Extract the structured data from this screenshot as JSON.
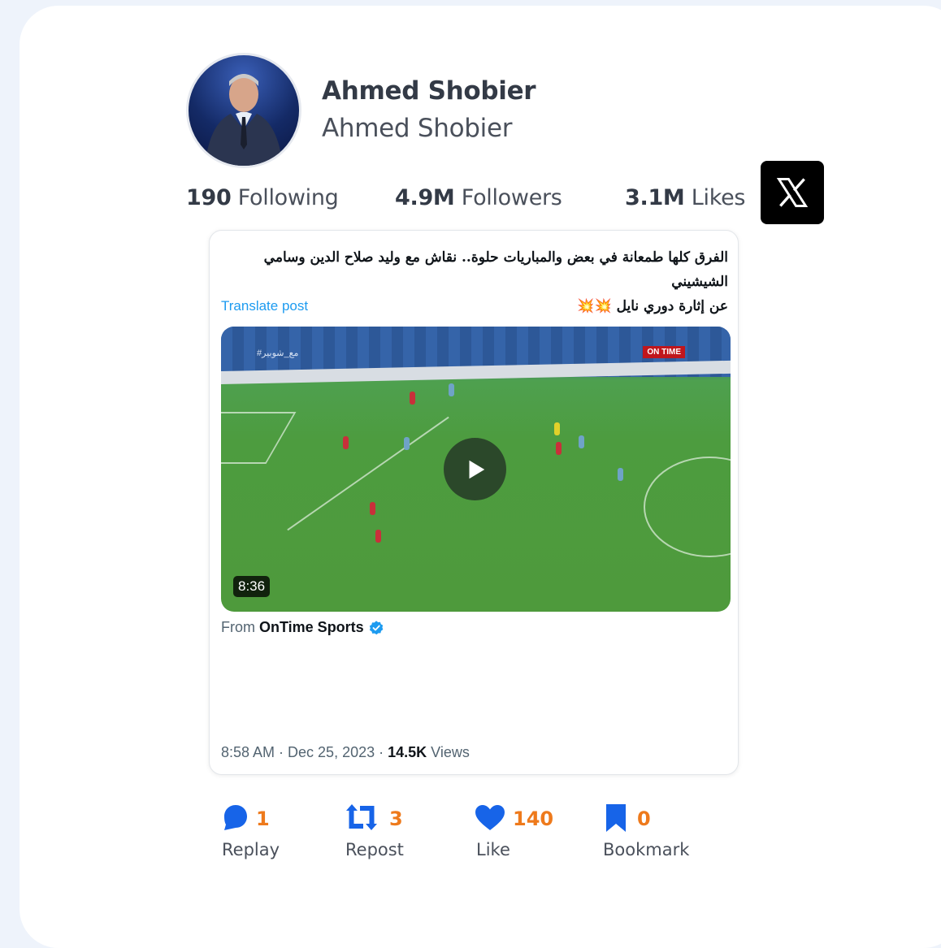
{
  "profile": {
    "name": "Ahmed Shobier",
    "handle": "Ahmed Shobier"
  },
  "stats": {
    "following_count": "190",
    "following_label": "Following",
    "followers_count": "4.9M",
    "followers_label": "Followers",
    "likes_count": "3.1M",
    "likes_label": "Likes"
  },
  "post": {
    "text_line1": "الفرق كلها طمعانة في بعض والمباريات حلوة.. نقاش مع وليد صلاح الدين وسامي الشيشيني",
    "text_line2": "عن إثارة دوري نايل 💥💥",
    "translate_label": "Translate post",
    "video_duration": "8:36",
    "video_channel_badge": "ON TIME",
    "video_hashtag": "#مع_شوبير",
    "from_prefix": "From",
    "from_source": "OnTime Sports",
    "time": "8:58 AM · Dec 25, 2023 · ",
    "views_count": "14.5K",
    "views_label": " Views"
  },
  "actions": {
    "reply_count": "1",
    "reply_label": "Replay",
    "repost_count": "3",
    "repost_label": "Repost",
    "like_count": "140",
    "like_label": "Like",
    "bookmark_count": "0",
    "bookmark_label": "Bookmark"
  },
  "icons": {
    "x": "x-logo-icon",
    "reply": "comment-icon",
    "repost": "repost-icon",
    "like": "heart-icon",
    "bookmark": "bookmark-icon",
    "verified": "verified-badge-icon",
    "play": "play-icon"
  },
  "colors": {
    "accent_blue": "#1764e8",
    "count_orange": "#ee7a1c",
    "link_blue": "#1d9bf0"
  }
}
